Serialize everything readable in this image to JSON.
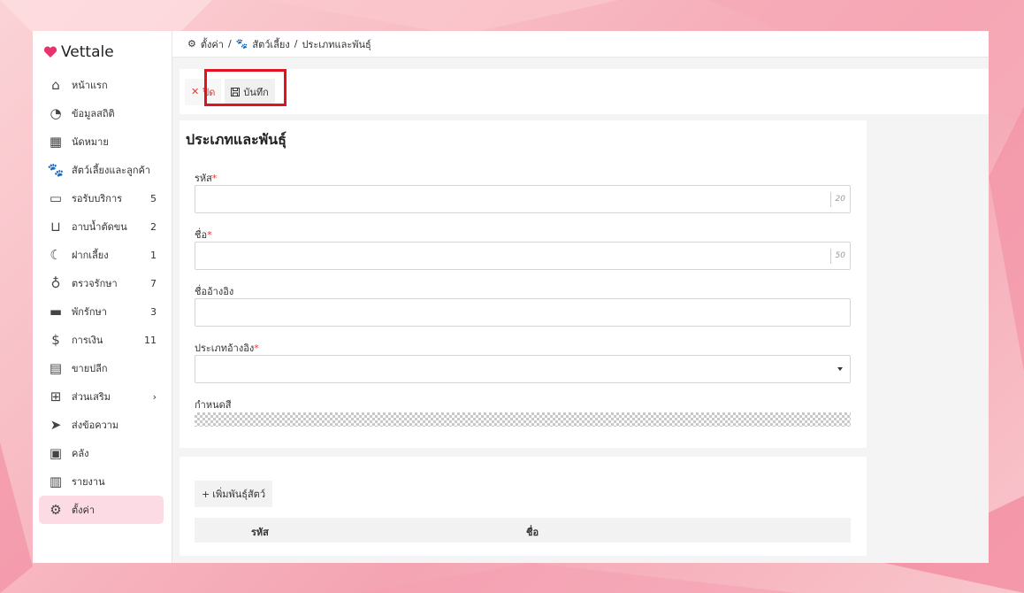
{
  "app": {
    "name": "Vettale",
    "brand_color": "#e8336d"
  },
  "breadcrumb": {
    "items": [
      "ตั้งค่า",
      "สัตว์เลี้ยง",
      "ประเภทและพันธุ์"
    ],
    "separator": "/"
  },
  "sidebar": {
    "items": [
      {
        "label": "หน้าแรก",
        "icon": "home-icon",
        "count": ""
      },
      {
        "label": "ข้อมูลสถิติ",
        "icon": "dashboard-icon",
        "count": ""
      },
      {
        "label": "นัดหมาย",
        "icon": "calendar-icon",
        "count": ""
      },
      {
        "label": "สัตว์เลี้ยงและลูกค้า",
        "icon": "paw-icon",
        "count": ""
      },
      {
        "label": "รอรับบริการ",
        "icon": "sofa-icon",
        "count": "5"
      },
      {
        "label": "อาบน้ำตัดขน",
        "icon": "bathtub-icon",
        "count": "2"
      },
      {
        "label": "ฝากเลี้ยง",
        "icon": "moon-icon",
        "count": "1"
      },
      {
        "label": "ตรวจรักษา",
        "icon": "stethoscope-icon",
        "count": "7"
      },
      {
        "label": "พักรักษา",
        "icon": "bed-icon",
        "count": "3"
      },
      {
        "label": "การเงิน",
        "icon": "money-hand-icon",
        "count": "11"
      },
      {
        "label": "ขายปลีก",
        "icon": "cash-register-icon",
        "count": ""
      },
      {
        "label": "ส่วนเสริม",
        "icon": "plus-square-icon",
        "count": "›"
      },
      {
        "label": "ส่งข้อความ",
        "icon": "send-icon",
        "count": ""
      },
      {
        "label": "คลัง",
        "icon": "archive-icon",
        "count": ""
      },
      {
        "label": "รายงาน",
        "icon": "bar-chart-icon",
        "count": ""
      },
      {
        "label": "ตั้งค่า",
        "icon": "gear-icon",
        "count": "",
        "active": true
      }
    ]
  },
  "toolbar": {
    "close_label": "ปิด",
    "save_label": "บันทึก"
  },
  "form": {
    "title": "ประเภทและพันธุ์",
    "code_label": "รหัส",
    "code_value": "",
    "code_max": "20",
    "name_label": "ชื่อ",
    "name_value": "",
    "name_max": "50",
    "ref_name_label": "ชื่ออ้างอิง",
    "ref_name_value": "",
    "ref_type_label": "ประเภทอ้างอิง",
    "ref_type_value": "",
    "color_label": "กำหนดสี",
    "required_mark": "*"
  },
  "breeds": {
    "add_label": "เพิ่มพันธุ์สัตว์",
    "columns": [
      "รหัส",
      "ชื่อ"
    ]
  }
}
